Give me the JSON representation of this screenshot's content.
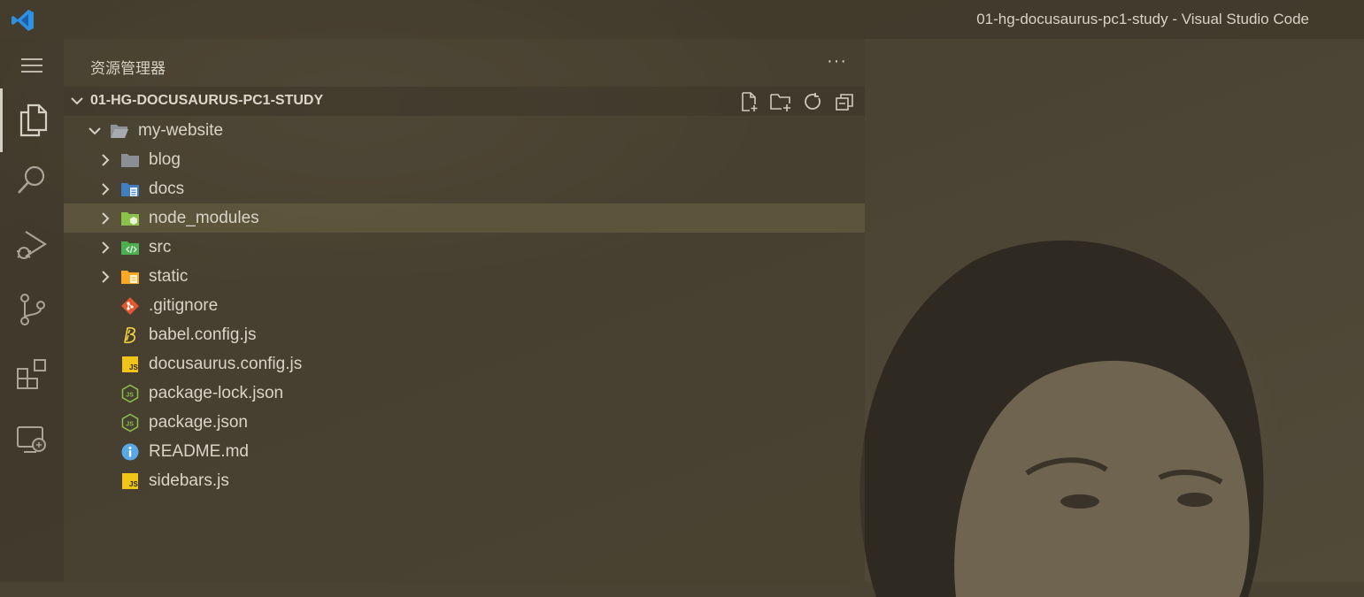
{
  "window": {
    "title": "01-hg-docusaurus-pc1-study - Visual Studio Code"
  },
  "activity_bar": {
    "items": [
      {
        "name": "menu-icon"
      },
      {
        "name": "explorer-icon"
      },
      {
        "name": "search-icon"
      },
      {
        "name": "run-debug-icon"
      },
      {
        "name": "source-control-icon"
      },
      {
        "name": "extensions-icon"
      },
      {
        "name": "remote-explorer-icon"
      }
    ]
  },
  "sidebar": {
    "title": "资源管理器",
    "more_label": "···",
    "section": {
      "title": "01-HG-DOCUSAURUS-PC1-STUDY",
      "actions": [
        "new-file-icon",
        "new-folder-icon",
        "refresh-icon",
        "collapse-all-icon"
      ]
    },
    "tree": [
      {
        "label": "my-website",
        "icon": "folder-open-icon",
        "expanded": true
      },
      {
        "label": "blog",
        "icon": "folder-icon"
      },
      {
        "label": "docs",
        "icon": "folder-docs-icon"
      },
      {
        "label": "node_modules",
        "icon": "folder-node-icon",
        "selected": true
      },
      {
        "label": "src",
        "icon": "folder-src-icon"
      },
      {
        "label": "static",
        "icon": "folder-static-icon"
      },
      {
        "label": ".gitignore",
        "icon": "git-icon"
      },
      {
        "label": "babel.config.js",
        "icon": "babel-icon"
      },
      {
        "label": "docusaurus.config.js",
        "icon": "js-icon"
      },
      {
        "label": "package-lock.json",
        "icon": "nodejs-icon"
      },
      {
        "label": "package.json",
        "icon": "nodejs-icon"
      },
      {
        "label": "README.md",
        "icon": "info-icon"
      },
      {
        "label": "sidebars.js",
        "icon": "js-icon"
      }
    ]
  },
  "colors": {
    "folder_gray": "#8a8f94",
    "folder_blue": "#4a8fd0",
    "folder_node": "#8bc34a",
    "folder_src": "#4caf50",
    "folder_static": "#f9a825",
    "git": "#e4572e",
    "babel": "#f5d53d",
    "js": "#f0c419",
    "nodejs": "#8bc34a",
    "info": "#5aa9e6"
  }
}
